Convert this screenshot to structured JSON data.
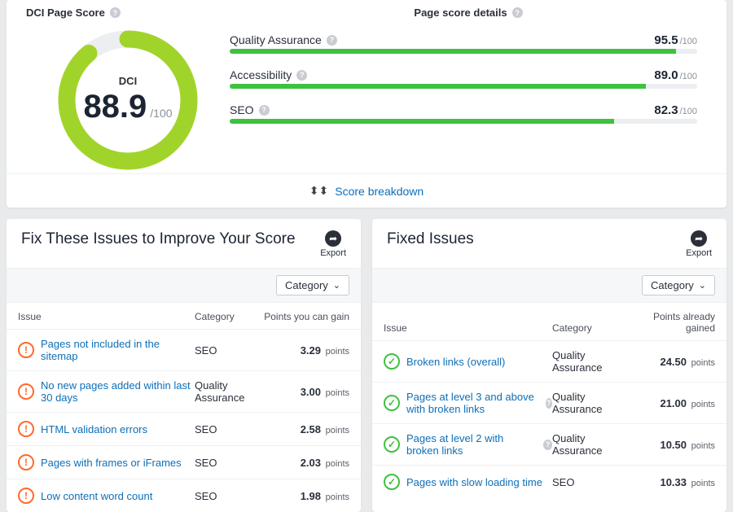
{
  "top": {
    "dci_title": "DCI Page Score",
    "details_title": "Page score details",
    "ring_label": "DCI",
    "score": "88.9",
    "score_max": "/100",
    "bars": [
      {
        "name": "Quality Assurance",
        "value": "95.5",
        "max": "/100",
        "pct": 95.5
      },
      {
        "name": "Accessibility",
        "value": "89.0",
        "max": "/100",
        "pct": 89.0
      },
      {
        "name": "SEO",
        "value": "82.3",
        "max": "/100",
        "pct": 82.3
      }
    ],
    "breakdown_label": "Score breakdown"
  },
  "shared": {
    "export_label": "Export",
    "category_label": "Category",
    "points_label": "points"
  },
  "improve": {
    "title": "Fix These Issues to Improve Your Score",
    "col_issue": "Issue",
    "col_category": "Category",
    "col_points": "Points you can gain",
    "rows": [
      {
        "issue": "Pages not included in the sitemap",
        "category": "SEO",
        "points": "3.29"
      },
      {
        "issue": "No new pages added within last 30 days",
        "category": "Quality Assurance",
        "points": "3.00"
      },
      {
        "issue": "HTML validation errors",
        "category": "SEO",
        "points": "2.58"
      },
      {
        "issue": "Pages with frames or iFrames",
        "category": "SEO",
        "points": "2.03"
      },
      {
        "issue": "Low content word count",
        "category": "SEO",
        "points": "1.98"
      }
    ]
  },
  "fixed": {
    "title": "Fixed Issues",
    "col_issue": "Issue",
    "col_category": "Category",
    "col_points": "Points already gained",
    "rows": [
      {
        "issue": "Broken links (overall)",
        "category": "Quality Assurance",
        "points": "24.50",
        "help": false
      },
      {
        "issue": "Pages at level 3 and above with broken links",
        "category": "Quality Assurance",
        "points": "21.00",
        "help": true
      },
      {
        "issue": "Pages at level 2 with broken links",
        "category": "Quality Assurance",
        "points": "10.50",
        "help": true
      },
      {
        "issue": "Pages with slow loading time",
        "category": "SEO",
        "points": "10.33",
        "help": false
      }
    ]
  }
}
